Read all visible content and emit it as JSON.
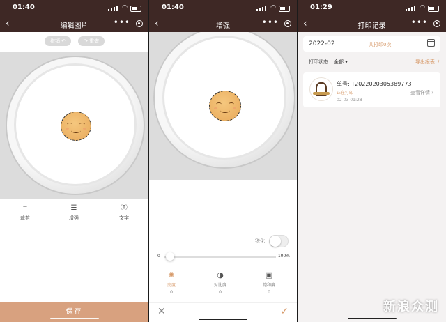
{
  "colors": {
    "header_bg": "#3e2825",
    "accent": "#d79a6a",
    "save_bg": "#d8a17f"
  },
  "screen_edit": {
    "time": "01:40",
    "title": "编辑图片",
    "undo_label": "撤销",
    "redo_label": "重做",
    "tools": [
      {
        "icon": "crop-icon",
        "label": "裁剪"
      },
      {
        "icon": "adjust-sliders-icon",
        "label": "增强"
      },
      {
        "icon": "text-icon",
        "label": "文字"
      }
    ],
    "save_label": "保存"
  },
  "screen_enhance": {
    "time": "01:40",
    "title": "增强",
    "sharpen_label": "锐化",
    "sharpen_on": false,
    "slider": {
      "min": "0",
      "max": "100%",
      "value": 0
    },
    "adjustments": [
      {
        "icon": "brightness-icon",
        "label": "亮度",
        "value": "0",
        "active": true
      },
      {
        "icon": "contrast-icon",
        "label": "对比度",
        "value": "0",
        "active": false
      },
      {
        "icon": "saturation-icon",
        "label": "饱和度",
        "value": "0",
        "active": false
      }
    ]
  },
  "screen_records": {
    "time": "01:29",
    "title": "打印记录",
    "month": "2022-02",
    "total": "共打印0次",
    "status_label": "打印状态",
    "status_value": "全部",
    "export_label": "导出报表",
    "records": [
      {
        "order_no": "单号: T2022020305389773",
        "status": "正在打印",
        "date": "02-03 01:28",
        "detail": "查看详情"
      }
    ],
    "watermark": "新浪众测"
  }
}
